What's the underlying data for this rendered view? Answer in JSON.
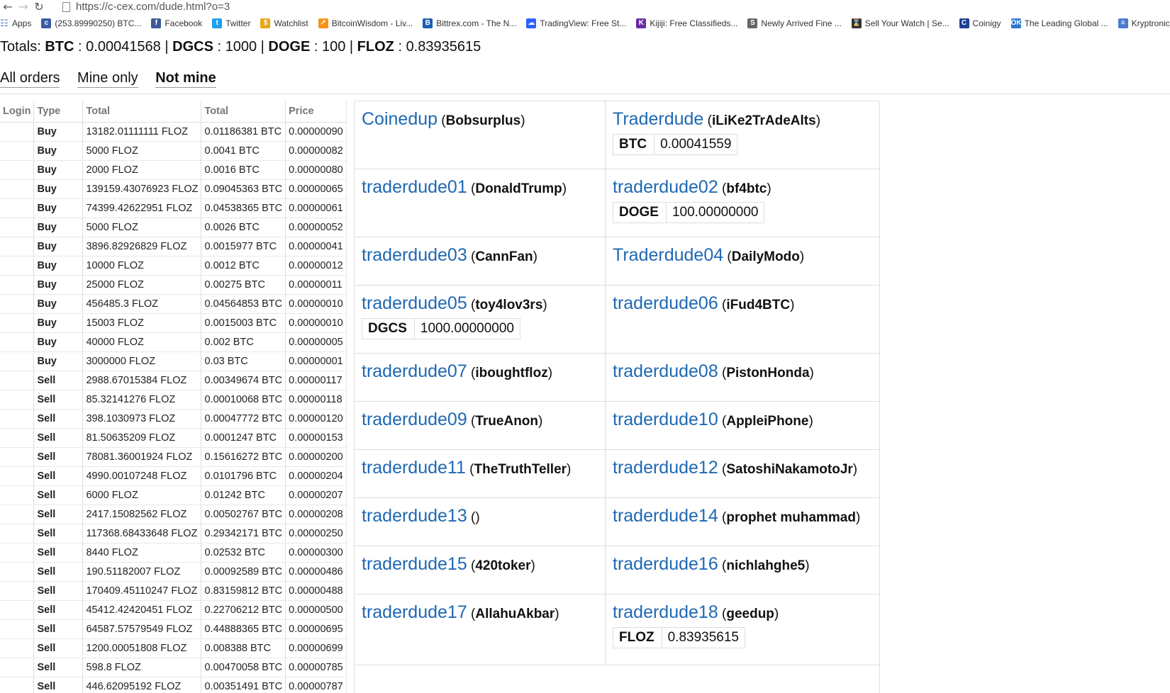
{
  "browser": {
    "url": "https://c-cex.com/dude.html?o=3",
    "bookmarks": [
      {
        "label": "Apps",
        "icon": "apps-grid-icon",
        "color": "#4a7bd0"
      },
      {
        "label": "(253.89990250) BTC...",
        "icon": "ccex-icon",
        "color": "#3b5ba8"
      },
      {
        "label": "Facebook",
        "icon": "facebook-icon",
        "color": "#3b5998"
      },
      {
        "label": "Twitter",
        "icon": "twitter-icon",
        "color": "#1da1f2"
      },
      {
        "label": "Watchlist",
        "icon": "watchlist-icon",
        "color": "#e6a817"
      },
      {
        "label": "BitcoinWisdom - Liv...",
        "icon": "bitcoinwisdom-icon",
        "color": "#f7931a"
      },
      {
        "label": "Bittrex.com - The N...",
        "icon": "bittrex-icon",
        "color": "#1b5fb4"
      },
      {
        "label": "TradingView: Free St...",
        "icon": "tradingview-icon",
        "color": "#2962ff"
      },
      {
        "label": "Kijiji: Free Classifieds...",
        "icon": "kijiji-icon",
        "color": "#6a2ca0"
      },
      {
        "label": "Newly Arrived Fine ...",
        "icon": "shop-icon",
        "color": "#666666"
      },
      {
        "label": "Sell Your Watch | Se...",
        "icon": "hourglass-icon",
        "color": "#333333"
      },
      {
        "label": "Coinigy",
        "icon": "coinigy-icon",
        "color": "#1d3f8f"
      },
      {
        "label": "The Leading Global ...",
        "icon": "okcoin-icon",
        "color": "#2a78d0"
      },
      {
        "label": "Kryptronics",
        "icon": "doc-icon",
        "color": "#4a7bd0"
      }
    ]
  },
  "totals": {
    "prefix": "Totals: ",
    "items": [
      {
        "sym": "BTC",
        "val": "0.00041568"
      },
      {
        "sym": "DGCS",
        "val": "1000"
      },
      {
        "sym": "DOGE",
        "val": "100"
      },
      {
        "sym": "FLOZ",
        "val": "0.83935615"
      }
    ]
  },
  "filters": {
    "all": "All orders",
    "mine": "Mine only",
    "notmine": "Not mine"
  },
  "orders": {
    "headers": {
      "login": "Login",
      "type": "Type",
      "total1": "Total",
      "total2": "Total",
      "price": "Price"
    },
    "rows": [
      {
        "type": "Buy",
        "t1": "13182.01111111 FLOZ",
        "t2": "0.01186381 BTC",
        "price": "0.00000090"
      },
      {
        "type": "Buy",
        "t1": "5000 FLOZ",
        "t2": "0.0041 BTC",
        "price": "0.00000082"
      },
      {
        "type": "Buy",
        "t1": "2000 FLOZ",
        "t2": "0.0016 BTC",
        "price": "0.00000080"
      },
      {
        "type": "Buy",
        "t1": "139159.43076923 FLOZ",
        "t2": "0.09045363 BTC",
        "price": "0.00000065"
      },
      {
        "type": "Buy",
        "t1": "74399.42622951 FLOZ",
        "t2": "0.04538365 BTC",
        "price": "0.00000061"
      },
      {
        "type": "Buy",
        "t1": "5000 FLOZ",
        "t2": "0.0026 BTC",
        "price": "0.00000052"
      },
      {
        "type": "Buy",
        "t1": "3896.82926829 FLOZ",
        "t2": "0.0015977 BTC",
        "price": "0.00000041"
      },
      {
        "type": "Buy",
        "t1": "10000 FLOZ",
        "t2": "0.0012 BTC",
        "price": "0.00000012"
      },
      {
        "type": "Buy",
        "t1": "25000 FLOZ",
        "t2": "0.00275 BTC",
        "price": "0.00000011"
      },
      {
        "type": "Buy",
        "t1": "456485.3 FLOZ",
        "t2": "0.04564853 BTC",
        "price": "0.00000010"
      },
      {
        "type": "Buy",
        "t1": "15003 FLOZ",
        "t2": "0.0015003 BTC",
        "price": "0.00000010"
      },
      {
        "type": "Buy",
        "t1": "40000 FLOZ",
        "t2": "0.002 BTC",
        "price": "0.00000005"
      },
      {
        "type": "Buy",
        "t1": "3000000 FLOZ",
        "t2": "0.03 BTC",
        "price": "0.00000001"
      },
      {
        "type": "Sell",
        "t1": "2988.67015384 FLOZ",
        "t2": "0.00349674 BTC",
        "price": "0.00000117"
      },
      {
        "type": "Sell",
        "t1": "85.32141276 FLOZ",
        "t2": "0.00010068 BTC",
        "price": "0.00000118"
      },
      {
        "type": "Sell",
        "t1": "398.1030973 FLOZ",
        "t2": "0.00047772 BTC",
        "price": "0.00000120"
      },
      {
        "type": "Sell",
        "t1": "81.50635209 FLOZ",
        "t2": "0.0001247 BTC",
        "price": "0.00000153"
      },
      {
        "type": "Sell",
        "t1": "78081.36001924 FLOZ",
        "t2": "0.15616272 BTC",
        "price": "0.00000200"
      },
      {
        "type": "Sell",
        "t1": "4990.00107248 FLOZ",
        "t2": "0.0101796 BTC",
        "price": "0.00000204"
      },
      {
        "type": "Sell",
        "t1": "6000 FLOZ",
        "t2": "0.01242 BTC",
        "price": "0.00000207"
      },
      {
        "type": "Sell",
        "t1": "2417.15082562 FLOZ",
        "t2": "0.00502767 BTC",
        "price": "0.00000208"
      },
      {
        "type": "Sell",
        "t1": "117368.68433648 FLOZ",
        "t2": "0.29342171 BTC",
        "price": "0.00000250"
      },
      {
        "type": "Sell",
        "t1": "8440 FLOZ",
        "t2": "0.02532 BTC",
        "price": "0.00000300"
      },
      {
        "type": "Sell",
        "t1": "190.51182007 FLOZ",
        "t2": "0.00092589 BTC",
        "price": "0.00000486"
      },
      {
        "type": "Sell",
        "t1": "170409.45110247 FLOZ",
        "t2": "0.83159812 BTC",
        "price": "0.00000488"
      },
      {
        "type": "Sell",
        "t1": "45412.42420451 FLOZ",
        "t2": "0.22706212 BTC",
        "price": "0.00000500"
      },
      {
        "type": "Sell",
        "t1": "64587.57579549 FLOZ",
        "t2": "0.44888365 BTC",
        "price": "0.00000695"
      },
      {
        "type": "Sell",
        "t1": "1200.00051808 FLOZ",
        "t2": "0.008388 BTC",
        "price": "0.00000699"
      },
      {
        "type": "Sell",
        "t1": "598.8 FLOZ",
        "t2": "0.00470058 BTC",
        "price": "0.00000785"
      },
      {
        "type": "Sell",
        "t1": "446.62095192 FLOZ",
        "t2": "0.00351491 BTC",
        "price": "0.00000787"
      }
    ]
  },
  "dudes": [
    {
      "name": "Coinedup",
      "user": "Bobsurplus",
      "bal": null
    },
    {
      "name": "Traderdude",
      "user": "iLiKe2TrAdeAlts",
      "bal": {
        "sym": "BTC",
        "amt": "0.00041559"
      }
    },
    {
      "name": "traderdude01",
      "user": "DonaldTrump",
      "bal": null
    },
    {
      "name": "traderdude02",
      "user": "bf4btc",
      "bal": {
        "sym": "DOGE",
        "amt": "100.00000000"
      }
    },
    {
      "name": "traderdude03",
      "user": "CannFan",
      "bal": null
    },
    {
      "name": "Traderdude04",
      "user": "DailyModo",
      "bal": null
    },
    {
      "name": "traderdude05",
      "user": "toy4lov3rs",
      "bal": {
        "sym": "DGCS",
        "amt": "1000.00000000"
      }
    },
    {
      "name": "traderdude06",
      "user": "iFud4BTC",
      "bal": null
    },
    {
      "name": "traderdude07",
      "user": "iboughtfloz",
      "bal": null
    },
    {
      "name": "traderdude08",
      "user": "PistonHonda",
      "bal": null
    },
    {
      "name": "traderdude09",
      "user": "TrueAnon",
      "bal": null
    },
    {
      "name": "traderdude10",
      "user": "AppleiPhone",
      "bal": null
    },
    {
      "name": "traderdude11",
      "user": "TheTruthTeller",
      "bal": null
    },
    {
      "name": "traderdude12",
      "user": "SatoshiNakamotoJr",
      "bal": null
    },
    {
      "name": "traderdude13",
      "user": "",
      "bal": null
    },
    {
      "name": "traderdude14",
      "user": "prophet muhammad",
      "bal": null
    },
    {
      "name": "traderdude15",
      "user": "420toker",
      "bal": null
    },
    {
      "name": "traderdude16",
      "user": "nichlahghe5",
      "bal": null
    },
    {
      "name": "traderdude17",
      "user": "AllahuAkbar",
      "bal": null
    },
    {
      "name": "traderdude18",
      "user": "geedup",
      "bal": {
        "sym": "FLOZ",
        "amt": "0.83935615"
      }
    }
  ]
}
